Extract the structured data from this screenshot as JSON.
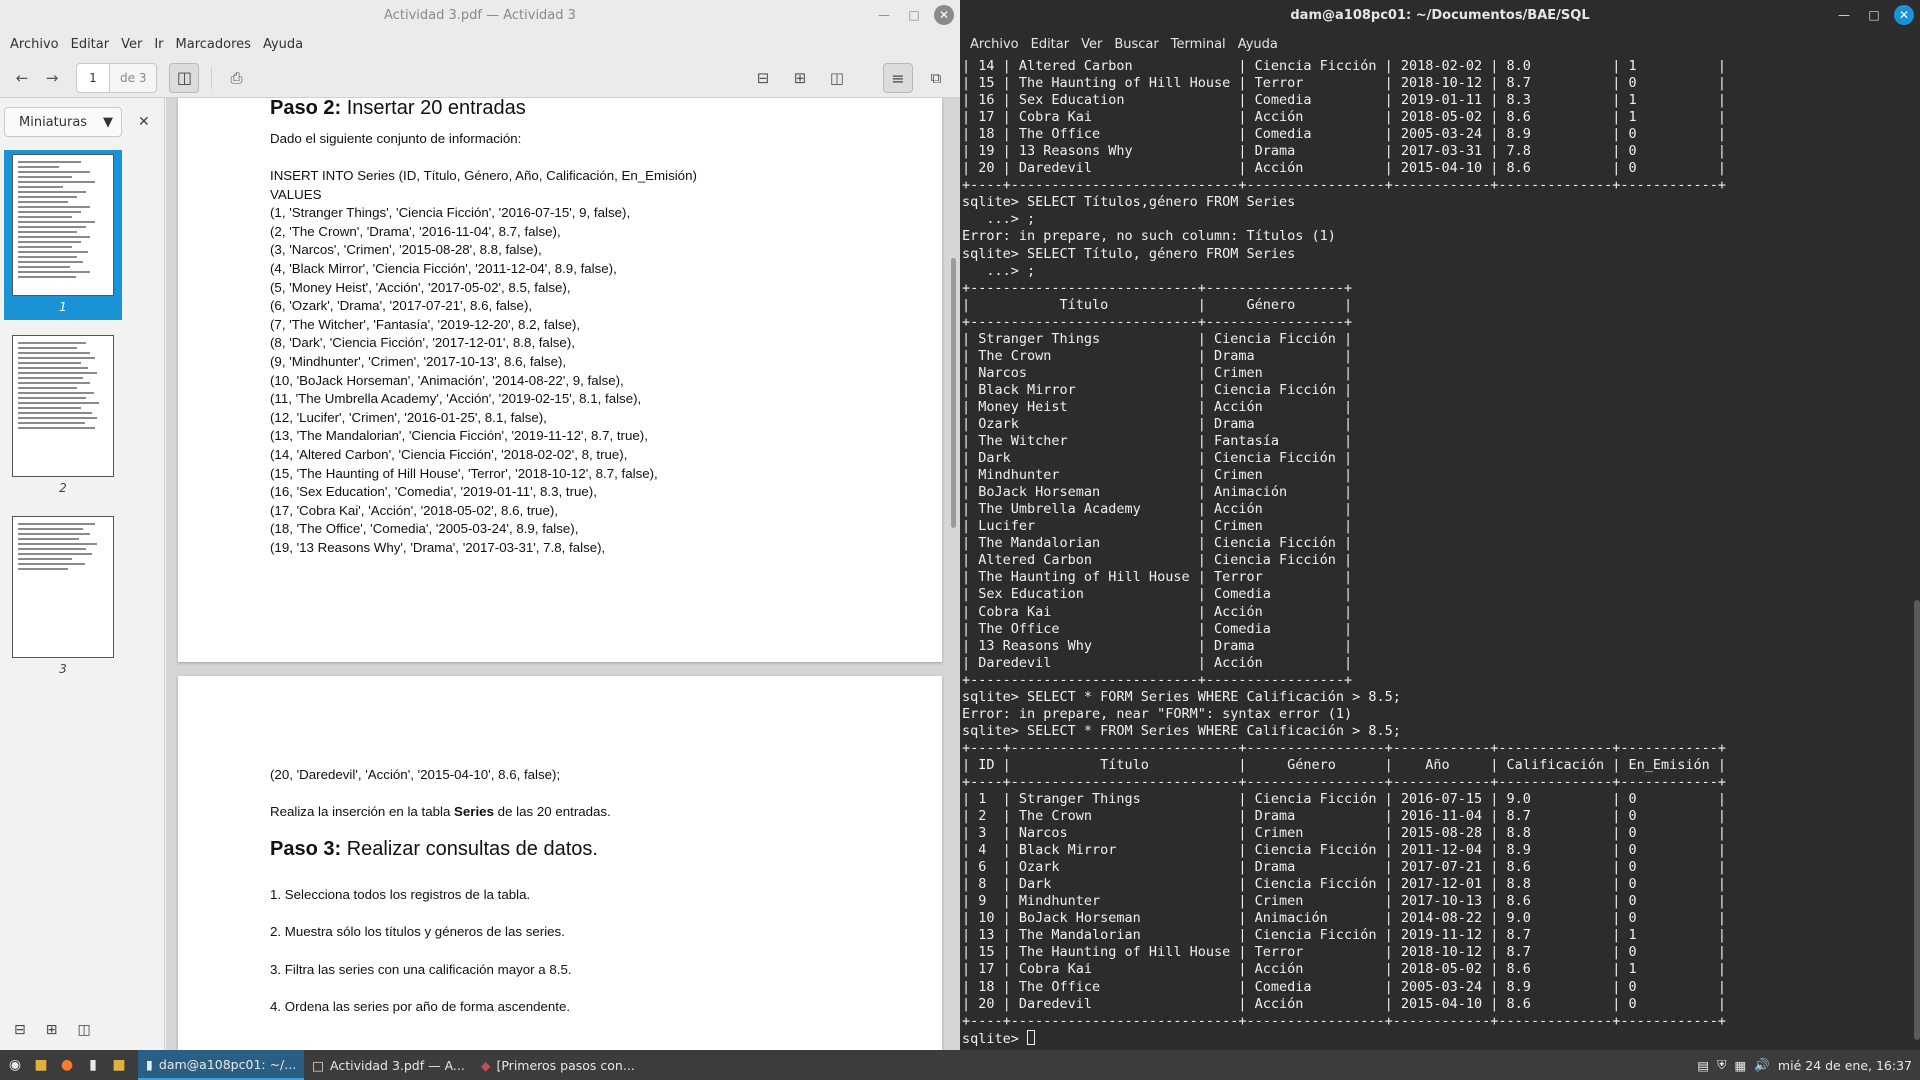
{
  "pdf": {
    "title": "Actividad 3.pdf — Actividad 3",
    "menu": [
      "Archivo",
      "Editar",
      "Ver",
      "Ir",
      "Marcadores",
      "Ayuda"
    ],
    "current_page": "1",
    "page_total": "de 3",
    "sidebar_mode": "Miniaturas",
    "thumb_labels": [
      "1",
      "2",
      "3"
    ],
    "page1": {
      "heading_bold": "Paso 2:",
      "heading_rest": " Insertar 20 entradas",
      "intro": "Dado el siguiente conjunto de información:",
      "sql": "INSERT INTO Series (ID, Título, Género, Año, Calificación, En_Emisión)\nVALUES\n(1, 'Stranger Things', 'Ciencia Ficción', '2016-07-15', 9, false),\n(2, 'The Crown', 'Drama', '2016-11-04', 8.7, false),\n(3, 'Narcos', 'Crimen', '2015-08-28', 8.8, false),\n(4, 'Black Mirror', 'Ciencia Ficción', '2011-12-04', 8.9, false),\n(5, 'Money Heist', 'Acción', '2017-05-02', 8.5, false),\n(6, 'Ozark', 'Drama', '2017-07-21', 8.6, false),\n(7, 'The Witcher', 'Fantasía', '2019-12-20', 8.2, false),\n(8, 'Dark', 'Ciencia Ficción', '2017-12-01', 8.8, false),\n(9, 'Mindhunter', 'Crimen', '2017-10-13', 8.6, false),\n(10, 'BoJack Horseman', 'Animación', '2014-08-22', 9, false),\n(11, 'The Umbrella Academy', 'Acción', '2019-02-15', 8.1, false),\n(12, 'Lucifer', 'Crimen', '2016-01-25', 8.1, false),\n(13, 'The Mandalorian', 'Ciencia Ficción', '2019-11-12', 8.7, true),\n(14, 'Altered Carbon', 'Ciencia Ficción', '2018-02-02', 8, true),\n(15, 'The Haunting of Hill House', 'Terror', '2018-10-12', 8.7, false),\n(16, 'Sex Education', 'Comedia', '2019-01-11', 8.3, true),\n(17, 'Cobra Kai', 'Acción', '2018-05-02', 8.6, true),\n(18, 'The Office', 'Comedia', '2005-03-24', 8.9, false),\n(19, '13 Reasons Why', 'Drama', '2017-03-31', 7.8, false),"
    },
    "page2": {
      "sql_cont": "(20, 'Daredevil', 'Acción', '2015-04-10', 8.6, false);",
      "insert_pre": "Realiza la inserción en la tabla ",
      "insert_bold": "Series",
      "insert_post": " de las 20 entradas.",
      "heading_bold": "Paso 3:",
      "heading_rest": " Realizar consultas de datos.",
      "items": [
        "1. Selecciona todos los registros de la tabla.",
        "2. Muestra sólo los títulos y géneros de las series.",
        "3. Filtra las series con una calificación mayor a 8.5.",
        "4. Ordena las series por año de forma ascendente."
      ]
    }
  },
  "terminal": {
    "title": "dam@a108pc01: ~/Documentos/BAE/SQL",
    "menu": [
      "Archivo",
      "Editar",
      "Ver",
      "Buscar",
      "Terminal",
      "Ayuda"
    ],
    "output": "| 14 | Altered Carbon             | Ciencia Ficción | 2018-02-02 | 8.0          | 1          |\n| 15 | The Haunting of Hill House | Terror          | 2018-10-12 | 8.7          | 0          |\n| 16 | Sex Education              | Comedia         | 2019-01-11 | 8.3          | 1          |\n| 17 | Cobra Kai                  | Acción          | 2018-05-02 | 8.6          | 1          |\n| 18 | The Office                 | Comedia         | 2005-03-24 | 8.9          | 0          |\n| 19 | 13 Reasons Why             | Drama           | 2017-03-31 | 7.8          | 0          |\n| 20 | Daredevil                  | Acción          | 2015-04-10 | 8.6          | 0          |\n+----+----------------------------+-----------------+------------+--------------+------------+\nsqlite> SELECT Títulos,género FROM Series\n   ...> ;\nError: in prepare, no such column: Títulos (1)\nsqlite> SELECT Título, género FROM Series\n   ...> ;\n+----------------------------+-----------------+\n|           Título           |     Género      |\n+----------------------------+-----------------+\n| Stranger Things            | Ciencia Ficción |\n| The Crown                  | Drama           |\n| Narcos                     | Crimen          |\n| Black Mirror               | Ciencia Ficción |\n| Money Heist                | Acción          |\n| Ozark                      | Drama           |\n| The Witcher                | Fantasía        |\n| Dark                       | Ciencia Ficción |\n| Mindhunter                 | Crimen          |\n| BoJack Horseman            | Animación       |\n| The Umbrella Academy       | Acción          |\n| Lucifer                    | Crimen          |\n| The Mandalorian            | Ciencia Ficción |\n| Altered Carbon             | Ciencia Ficción |\n| The Haunting of Hill House | Terror          |\n| Sex Education              | Comedia         |\n| Cobra Kai                  | Acción          |\n| The Office                 | Comedia         |\n| 13 Reasons Why             | Drama           |\n| Daredevil                  | Acción          |\n+----------------------------+-----------------+\nsqlite> SELECT * FORM Series WHERE Calificación > 8.5;\nError: in prepare, near \"FORM\": syntax error (1)\nsqlite> SELECT * FROM Series WHERE Calificación > 8.5;\n+----+----------------------------+-----------------+------------+--------------+------------+\n| ID |           Título           |     Género      |    Año     | Calificación | En_Emisión |\n+----+----------------------------+-----------------+------------+--------------+------------+\n| 1  | Stranger Things            | Ciencia Ficción | 2016-07-15 | 9.0          | 0          |\n| 2  | The Crown                  | Drama           | 2016-11-04 | 8.7          | 0          |\n| 3  | Narcos                     | Crimen          | 2015-08-28 | 8.8          | 0          |\n| 4  | Black Mirror               | Ciencia Ficción | 2011-12-04 | 8.9          | 0          |\n| 6  | Ozark                      | Drama           | 2017-07-21 | 8.6          | 0          |\n| 8  | Dark                       | Ciencia Ficción | 2017-12-01 | 8.8          | 0          |\n| 9  | Mindhunter                 | Crimen          | 2017-10-13 | 8.6          | 0          |\n| 10 | BoJack Horseman            | Animación       | 2014-08-22 | 9.0          | 0          |\n| 13 | The Mandalorian            | Ciencia Ficción | 2019-11-12 | 8.7          | 1          |\n| 15 | The Haunting of Hill House | Terror          | 2018-10-12 | 8.7          | 0          |\n| 17 | Cobra Kai                  | Acción          | 2018-05-02 | 8.6          | 1          |\n| 18 | The Office                 | Comedia         | 2005-03-24 | 8.9          | 0          |\n| 20 | Daredevil                  | Acción          | 2015-04-10 | 8.6          | 0          |\n+----+----------------------------+-----------------+------------+--------------+------------+",
    "prompt": "sqlite> "
  },
  "taskbar": {
    "tasks": [
      "dam@a108pc01: ~/...",
      "Actividad 3.pdf — A...",
      "[Primeros pasos con..."
    ],
    "clock": "mié 24 de ene, 16:37"
  },
  "colors": {
    "accent": "#1a93d6",
    "terminal_bg": "#2c2c2c",
    "pdf_bg": "#d6d6d6"
  }
}
